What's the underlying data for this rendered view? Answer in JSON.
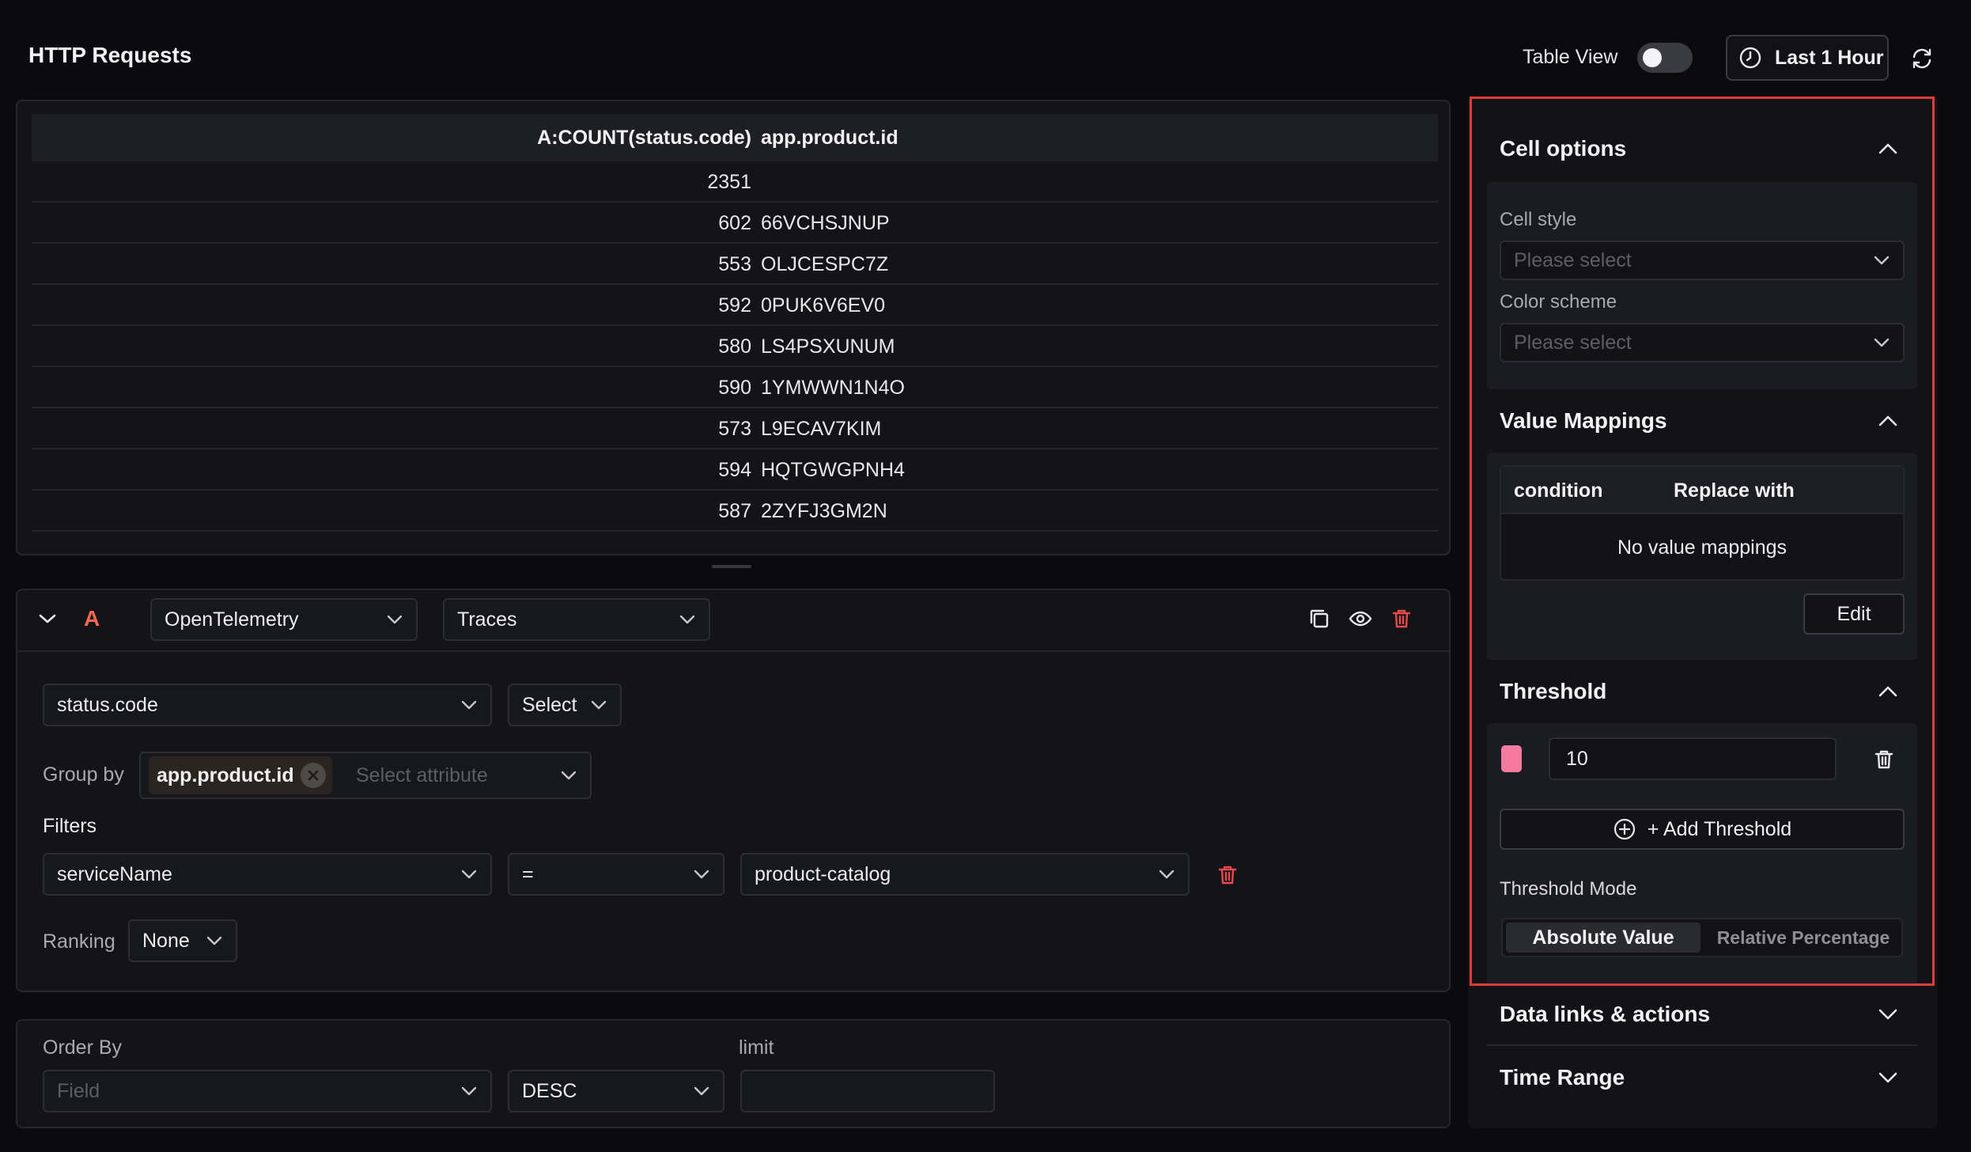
{
  "header": {
    "title": "HTTP Requests",
    "table_view_label": "Table View",
    "time_range_label": "Last 1 Hour"
  },
  "table": {
    "columns": [
      "A:COUNT(status.code)",
      "app.product.id"
    ],
    "rows": [
      {
        "count": "2351",
        "product": ""
      },
      {
        "count": "602",
        "product": "66VCHSJNUP"
      },
      {
        "count": "553",
        "product": "OLJCESPC7Z"
      },
      {
        "count": "592",
        "product": "0PUK6V6EV0"
      },
      {
        "count": "580",
        "product": "LS4PSXUNUM"
      },
      {
        "count": "590",
        "product": "1YMWWN1N4O"
      },
      {
        "count": "573",
        "product": "L9ECAV7KIM"
      },
      {
        "count": "594",
        "product": "HQTGWGPNH4"
      },
      {
        "count": "587",
        "product": "2ZYFJ3GM2N"
      }
    ]
  },
  "query": {
    "letter": "A",
    "datasource": "OpenTelemetry",
    "signal": "Traces",
    "metric_field": "status.code",
    "aggregation": "Select",
    "group_by_label": "Group by",
    "group_by_chip": "app.product.id",
    "group_by_placeholder": "Select attribute",
    "filters_label": "Filters",
    "filter_field": "serviceName",
    "filter_operator": "=",
    "filter_value": "product-catalog",
    "ranking_label": "Ranking",
    "ranking_value": "None"
  },
  "order": {
    "order_by_label": "Order By",
    "field_placeholder": "Field",
    "direction": "DESC",
    "limit_label": "limit",
    "limit_value": ""
  },
  "sidebar": {
    "cell_options": {
      "title": "Cell options",
      "cell_style_label": "Cell style",
      "cell_style_placeholder": "Please select",
      "color_scheme_label": "Color scheme",
      "color_scheme_placeholder": "Please select"
    },
    "value_mappings": {
      "title": "Value Mappings",
      "col_condition": "condition",
      "col_replace": "Replace with",
      "empty_text": "No value mappings",
      "edit_label": "Edit"
    },
    "threshold": {
      "title": "Threshold",
      "value": "10",
      "swatch_color": "#f47aa0",
      "add_label": "+ Add Threshold",
      "mode_label": "Threshold Mode",
      "mode_active": "Absolute Value",
      "mode_inactive": "Relative Percentage"
    },
    "data_links_title": "Data links & actions",
    "time_range_title": "Time Range"
  },
  "colors": {
    "accent_letter": "#f06a4b",
    "danger": "#e5484d",
    "highlight_border": "#e03b3b"
  }
}
